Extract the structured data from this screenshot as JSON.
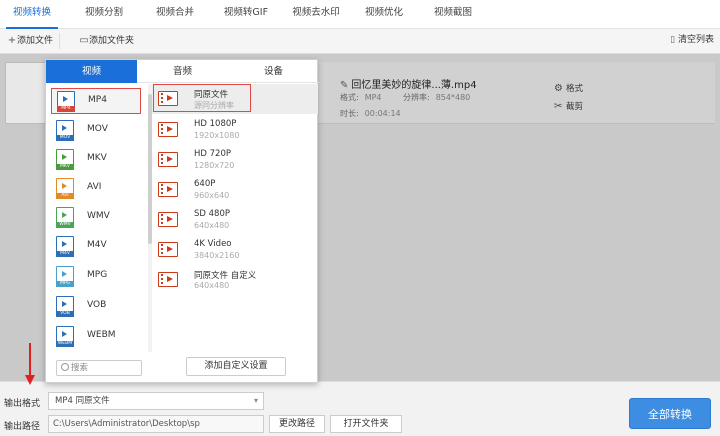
{
  "top_tabs": [
    {
      "label": "视频转换"
    },
    {
      "label": "视频分割"
    },
    {
      "label": "视频合并"
    },
    {
      "label": "视频转GIF"
    },
    {
      "label": "视频去水印"
    },
    {
      "label": "视频优化"
    },
    {
      "label": "视频截图"
    }
  ],
  "toolbar": {
    "add_file": "添加文件",
    "add_folder": "添加文件夹",
    "clear_list": "清空列表"
  },
  "file": {
    "name": "回忆里美妙的旋律...薄.mp4",
    "format_label": "格式:",
    "format_value": "MP4",
    "resolution_label": "分辨率:",
    "resolution_value": "854*480",
    "duration_label": "时长:",
    "duration_value": "00:04:14",
    "format_action": "格式",
    "clip_action": "截剪"
  },
  "popup": {
    "tabs": [
      {
        "label": "视频"
      },
      {
        "label": "音频"
      },
      {
        "label": "设备"
      }
    ],
    "formats": [
      {
        "name": "MP4",
        "band": "MP4",
        "color": "#d6453a"
      },
      {
        "name": "MOV",
        "band": "MOV",
        "color": "#2d6fb5"
      },
      {
        "name": "MKV",
        "band": "MKV",
        "color": "#4a9a3e"
      },
      {
        "name": "AVI",
        "band": "AVI",
        "color": "#e38a26"
      },
      {
        "name": "WMV",
        "band": "WMV",
        "color": "#4aa55a"
      },
      {
        "name": "M4V",
        "band": "M4V",
        "color": "#2d6fb5"
      },
      {
        "name": "MPG",
        "band": "MPG",
        "color": "#4aa0c8"
      },
      {
        "name": "VOB",
        "band": "VOB",
        "color": "#2d6fb5"
      },
      {
        "name": "WEBM",
        "band": "WEBM",
        "color": "#2d6fb5"
      }
    ],
    "search_placeholder": "搜索",
    "presets": [
      {
        "title": "同原文件",
        "sub": "源同分辨率"
      },
      {
        "title": "HD 1080P",
        "sub": "1920x1080"
      },
      {
        "title": "HD 720P",
        "sub": "1280x720"
      },
      {
        "title": "640P",
        "sub": "960x640"
      },
      {
        "title": "SD 480P",
        "sub": "640x480"
      },
      {
        "title": "4K Video",
        "sub": "3840x2160"
      },
      {
        "title": "同原文件 自定义",
        "sub": "640x480"
      }
    ],
    "add_preset": "添加自定义设置"
  },
  "bottom": {
    "output_format_label": "输出格式",
    "output_format_value": "MP4  同原文件",
    "output_path_label": "输出路径",
    "output_path_value": "C:\\Users\\Administrator\\Desktop\\sp",
    "change_path": "更改路径",
    "open_folder": "打开文件夹",
    "convert_all": "全部转换"
  },
  "colors": {
    "accent": "#1a6fd8",
    "convert_button": "#3d8de3",
    "highlight": "#e04848"
  }
}
